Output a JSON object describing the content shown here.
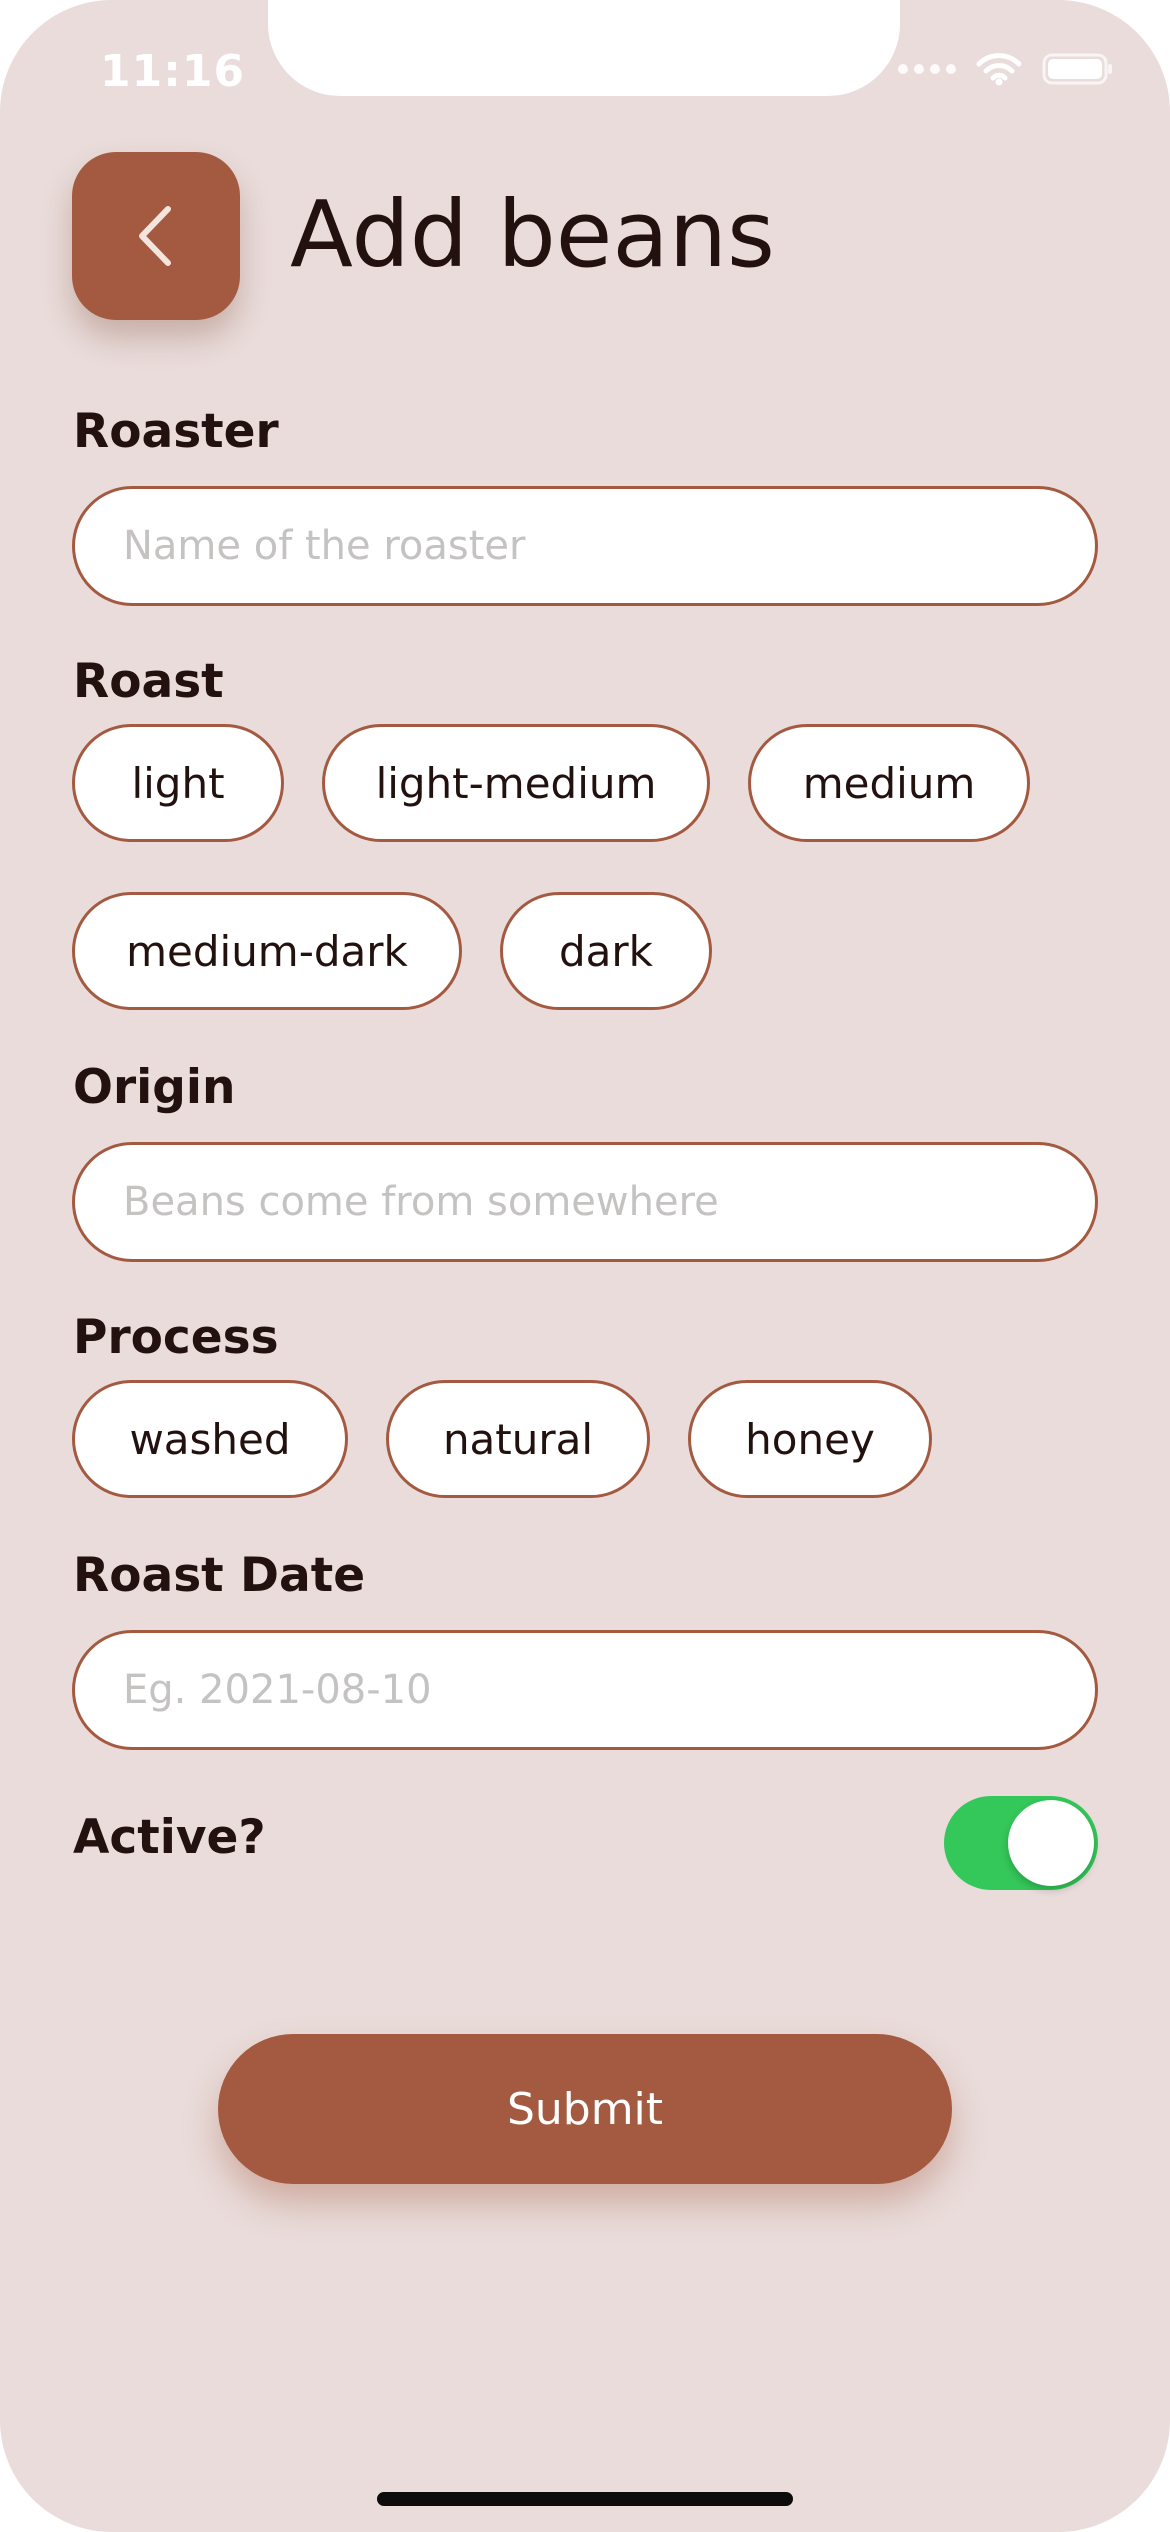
{
  "status_bar": {
    "time": "11:16"
  },
  "header": {
    "back_icon": "chevron-left-icon",
    "title": "Add beans"
  },
  "form": {
    "roaster": {
      "label": "Roaster",
      "placeholder": "Name of the roaster",
      "value": ""
    },
    "roast": {
      "label": "Roast",
      "options": [
        "light",
        "light-medium",
        "medium",
        "medium-dark",
        "dark"
      ]
    },
    "origin": {
      "label": "Origin",
      "placeholder": "Beans come from somewhere",
      "value": ""
    },
    "process": {
      "label": "Process",
      "options": [
        "washed",
        "natural",
        "honey"
      ]
    },
    "roast_date": {
      "label": "Roast Date",
      "placeholder": "Eg. 2021-08-10",
      "value": ""
    },
    "active": {
      "label": "Active?",
      "on": true
    },
    "submit_label": "Submit"
  },
  "colors": {
    "background": "#e9dcda",
    "accent": "#a45a40",
    "toggle_on": "#34c759",
    "text": "#22110e",
    "placeholder": "#c5c2c2"
  }
}
